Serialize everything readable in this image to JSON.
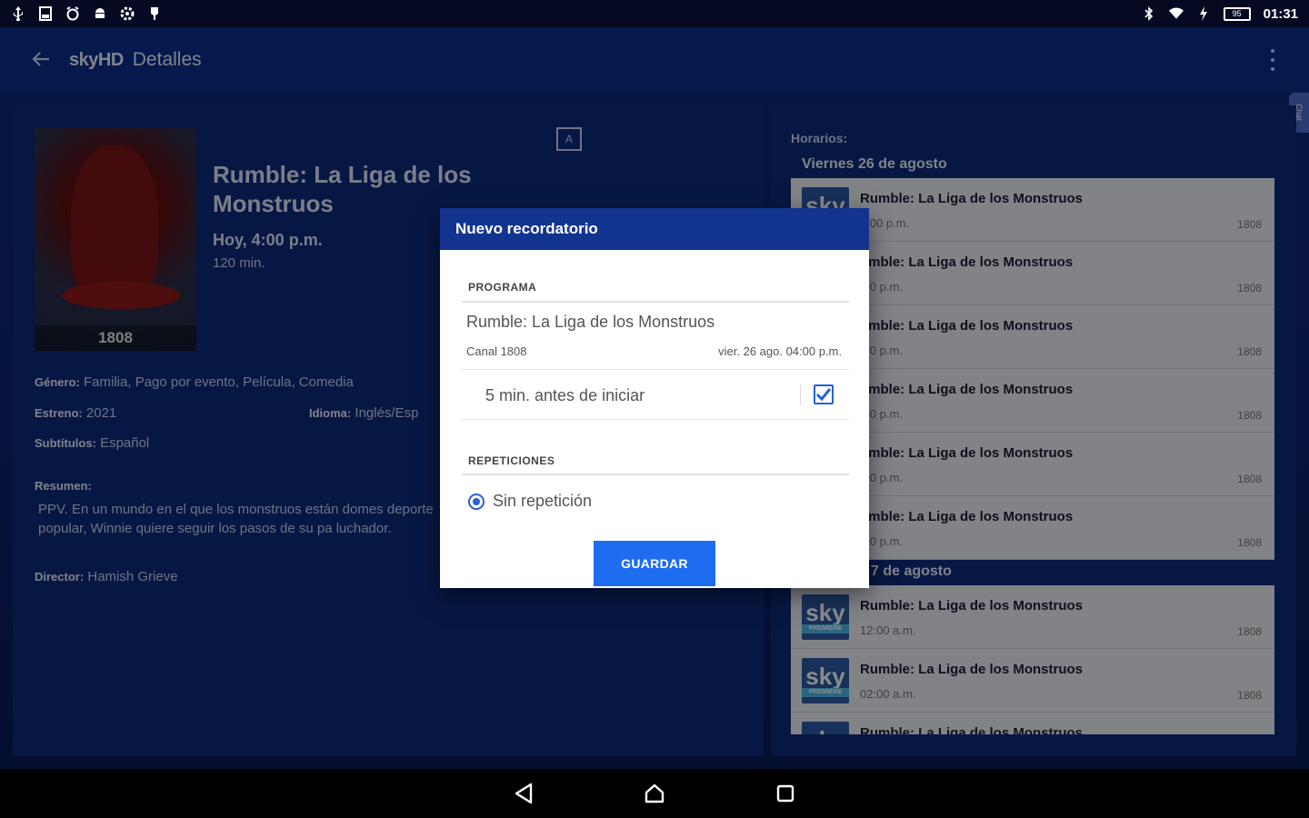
{
  "status_bar": {
    "time": "01:31",
    "battery": "95"
  },
  "toolbar": {
    "logo": "skyHD",
    "title": "Detalles"
  },
  "chat_tab": "Chat",
  "movie": {
    "channel_badge": "1808",
    "audio_badge": "A",
    "title": "Rumble: La Liga de los Monstruos",
    "air_time": "Hoy, 4:00 p.m.",
    "duration": "120 min.",
    "genre_label": "Género:",
    "genre": "Familia, Pago por evento, Película, Comedia",
    "release_label": "Estreno:",
    "release": "2021",
    "language_label": "Idioma:",
    "language": "Inglés/Esp",
    "subtitles_label": "Subtítulos:",
    "subtitles": "Español",
    "summary_label": "Resumen:",
    "summary": "PPV. En un mundo en el que los monstruos están domes deporte popular, Winnie quiere seguir los pasos de su pa luchador.",
    "director_label": "Director:",
    "director": "Hamish Grieve"
  },
  "schedule": {
    "label": "Horarios:",
    "days": [
      {
        "header": "Viernes 26 de agosto",
        "rows": [
          {
            "title": "Rumble: La Liga de los Monstruos",
            "time": "2:00 p.m.",
            "channel": "1808"
          },
          {
            "title": "umble: La Liga de los Monstruos",
            "time": ":00 p.m.",
            "channel": "1808"
          },
          {
            "title": "umble: La Liga de los Monstruos",
            "time": ":00 p.m.",
            "channel": "1808"
          },
          {
            "title": "umble: La Liga de los Monstruos",
            "time": ":00 p.m.",
            "channel": "1808"
          },
          {
            "title": "umble: La Liga de los Monstruos",
            "time": ":00 p.m.",
            "channel": "1808"
          },
          {
            "title": "umble: La Liga de los Monstruos",
            "time": ":00 p.m.",
            "channel": "1808"
          }
        ]
      },
      {
        "header": "7 de agosto",
        "rows": [
          {
            "title": "Rumble: La Liga de los Monstruos",
            "time": "12:00 a.m.",
            "channel": "1808"
          },
          {
            "title": "Rumble: La Liga de los Monstruos",
            "time": "02:00 a.m.",
            "channel": "1808"
          },
          {
            "title": "Rumble: La Liga de los Monstruos",
            "time": "",
            "channel": ""
          }
        ]
      }
    ]
  },
  "sky_logo": {
    "text": "sky",
    "sub": "PREMIERE"
  },
  "dialog": {
    "title": "Nuevo recordatorio",
    "program_section": "PROGRAMA",
    "program_name": "Rumble: La Liga de los Monstruos",
    "program_channel": "Canal 1808",
    "program_date": "vier. 26 ago. 04:00 p.m.",
    "reminder_text": "5 min. antes de iniciar",
    "reminder_checked": true,
    "repeat_section": "REPETICIONES",
    "repeat_option": "Sin repetición",
    "save_label": "GUARDAR"
  },
  "colors": {
    "accent": "#1e6cf0",
    "dialog_header": "#12348f",
    "background": "#0a2470"
  }
}
